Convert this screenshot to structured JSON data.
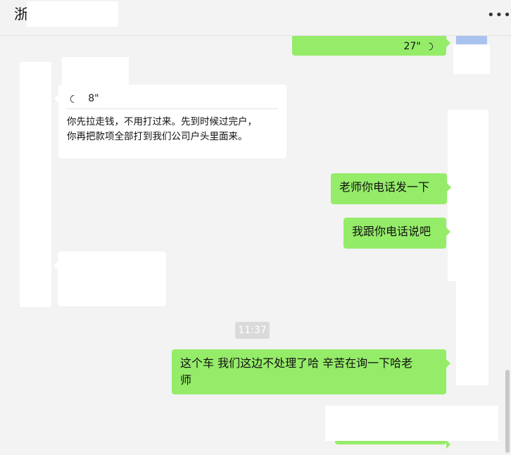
{
  "header": {
    "title": "浙",
    "more_label": "•••"
  },
  "messages": {
    "out_voice_duration": "27\"",
    "quoted_voice_duration": "8\"",
    "incoming_text_line1": "你先拉走钱，不用打过来。先到时候过完户，",
    "incoming_text_line2": "你再把款项全部打到我们公司户头里面来。",
    "out_msg_1": "老师你电话发一下",
    "out_msg_2": "我跟你电话说吧",
    "timestamp": "11:37",
    "out_msg_3_line1": "这个车 我们这边不处理了哈  辛苦在询一下哈老",
    "out_msg_3_line2": "师"
  },
  "icons": {
    "voice": "voice-wave-icon",
    "more": "more-dots-icon"
  },
  "colors": {
    "outgoing_bubble": "#95ec69",
    "incoming_bubble": "#ffffff",
    "background": "#f3f3f3",
    "timestamp_badge": "#dadada"
  }
}
